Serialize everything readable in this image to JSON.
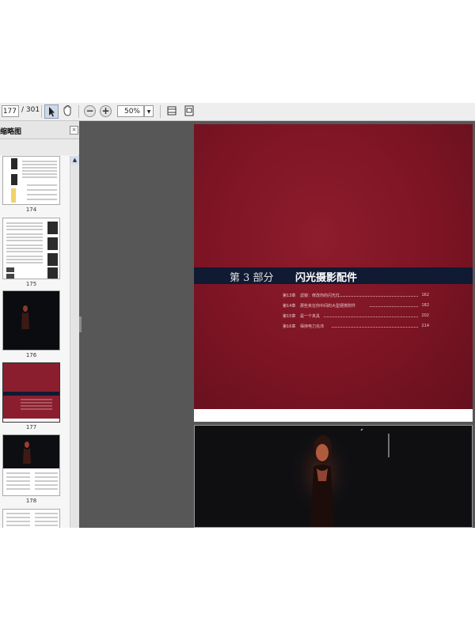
{
  "toolbar": {
    "page_current": "177",
    "page_total": "/ 301",
    "zoom": "50%",
    "icons": [
      "select-arrow-icon",
      "hand-icon",
      "zoom-out-icon",
      "zoom-in-icon",
      "dropdown-icon",
      "fit-page-icon",
      "fit-width-icon"
    ]
  },
  "sidebar": {
    "title": "缩略图",
    "thumbnails": [
      {
        "label": "174"
      },
      {
        "label": "175"
      },
      {
        "label": "176"
      },
      {
        "label": "177",
        "selected": true
      },
      {
        "label": "178"
      }
    ]
  },
  "document": {
    "part_label": "第 3 部分",
    "part_title": "闪光摄影配件",
    "toc": [
      {
        "chapter": "第13章",
        "title": "滤镜：修改你的闪光灯",
        "page": "162"
      },
      {
        "chapter": "第14章",
        "title": "那些夹在你中间的大型便携附件",
        "page": "182"
      },
      {
        "chapter": "第15章",
        "title": "是一个夹具",
        "page": "202"
      },
      {
        "chapter": "第16章",
        "title": "保持电力充沛",
        "page": "214"
      }
    ]
  },
  "colors": {
    "page_red": "#7c1424",
    "band_navy": "#111a33",
    "viewer_bg": "#575757"
  }
}
